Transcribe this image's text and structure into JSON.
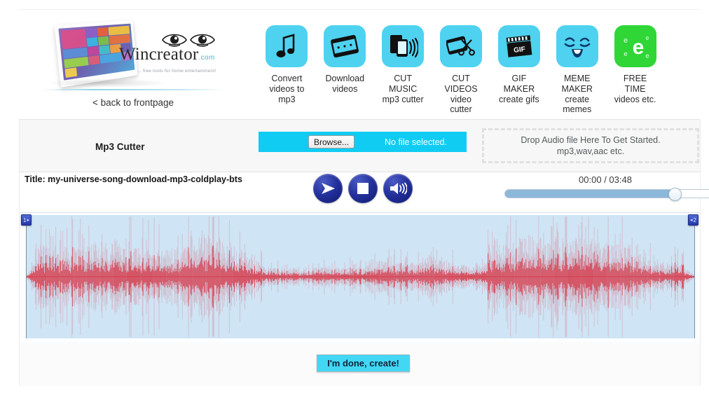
{
  "brand": {
    "name": "Wincreator",
    "domain_suffix": ".com",
    "tagline": "... free tools for home entertainment!",
    "back_link": "< back to frontpage"
  },
  "nav": {
    "items": [
      {
        "icon": "music-note-icon",
        "label": "Convert\nvideos to\nmp3",
        "color": "#4ed2f0"
      },
      {
        "icon": "film-strip-icon",
        "label": "Download\nvideos",
        "color": "#4ed2f0"
      },
      {
        "icon": "phone-audio-icon",
        "label": "CUT\nMUSIC\nmp3 cutter",
        "color": "#4ed2f0"
      },
      {
        "icon": "scissors-film-icon",
        "label": "CUT\nVIDEOS\nvideo\ncutter",
        "color": "#4ed2f0"
      },
      {
        "icon": "gif-clapper-icon",
        "label": "GIF\nMAKER\ncreate gifs",
        "color": "#4ed2f0"
      },
      {
        "icon": "smiley-face-icon",
        "label": "MEME\nMAKER\ncreate\nmemes",
        "color": "#4ed2f0"
      },
      {
        "icon": "letter-e-icon",
        "label": "FREE\nTIME\nvideos etc.",
        "color": "#2fd636"
      }
    ]
  },
  "tool": {
    "title": "Mp3 Cutter",
    "browse_label": "Browse...",
    "file_status": "No file selected.",
    "dropzone_line1": "Drop Audio file Here To Get Started.",
    "dropzone_line2": "mp3,wav,aac etc.",
    "file_row_color": "#10ccf3"
  },
  "player": {
    "track_title": "Title: my-universe-song-download-mp3-coldplay-bts",
    "buttons": [
      {
        "name": "play-button",
        "icon": "play-icon"
      },
      {
        "name": "stop-button",
        "icon": "stop-icon"
      },
      {
        "name": "volume-button",
        "icon": "speaker-icon"
      }
    ],
    "time_current": "00:00",
    "time_total": "03:48",
    "time_display": "00:00 / 03:48",
    "slider_percent": 80
  },
  "waveform": {
    "marker_left_label": "1",
    "marker_right_label": "2",
    "wave_color": "#d63a4a",
    "selection_color": "#cfe4f4"
  },
  "footer": {
    "create_label": "I'm done, create!",
    "create_color": "#41d7f5"
  }
}
